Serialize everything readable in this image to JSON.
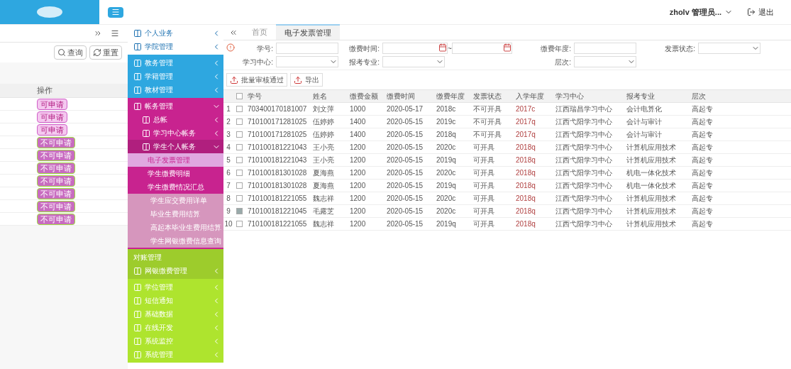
{
  "header": {
    "user": "zholv 管理员...",
    "logout": "退出"
  },
  "back_panel": {
    "buttons": [
      "查询",
      "重置"
    ],
    "column": "操作",
    "rows": [
      {
        "label": "可申请",
        "enabled": true
      },
      {
        "label": "可申请",
        "enabled": true
      },
      {
        "label": "可申请",
        "enabled": true
      },
      {
        "label": "不可申请",
        "enabled": false
      },
      {
        "label": "不可申请",
        "enabled": false
      },
      {
        "label": "不可申请",
        "enabled": false
      },
      {
        "label": "不可申请",
        "enabled": false
      },
      {
        "label": "不可申请",
        "enabled": false
      },
      {
        "label": "不可申请",
        "enabled": false
      },
      {
        "label": "不可申请",
        "enabled": false
      }
    ]
  },
  "sidebar": {
    "groups": [
      {
        "color": "#ffffff",
        "items": [
          {
            "label": "个人业务",
            "expanded": false,
            "selected": false
          },
          {
            "label": "学院管理",
            "expanded": false,
            "selected": false
          }
        ]
      },
      {
        "color": "#2ea7e0",
        "items": [
          {
            "label": "教务管理",
            "expanded": false,
            "selected": false
          },
          {
            "label": "学籍管理",
            "expanded": false,
            "selected": false
          },
          {
            "label": "教材管理",
            "expanded": false,
            "selected": false
          }
        ]
      },
      {
        "color": "#c8238f",
        "items": [
          {
            "label": "帐务管理",
            "expanded": true,
            "selected": false,
            "children": [
              {
                "label": "总帐",
                "expanded": false,
                "selected": false
              },
              {
                "label": "学习中心帐务",
                "expanded": false,
                "selected": false
              },
              {
                "label": "学生个人帐务",
                "expanded": true,
                "selected": false,
                "children": [
                  {
                    "label": "电子发票管理",
                    "selected": true
                  },
                  {
                    "label": "学生缴费明细",
                    "selected": false
                  },
                  {
                    "label": "学生缴费情况汇总",
                    "selected": false,
                    "children": [
                      {
                        "label": "学生应交费用详单",
                        "selected": false
                      },
                      {
                        "label": "毕业生费用结算",
                        "selected": false
                      },
                      {
                        "label": "高起本毕业生费用结算",
                        "selected": false
                      },
                      {
                        "label": "学生网银缴费信息查询",
                        "selected": false
                      }
                    ]
                  }
                ]
              }
            ]
          }
        ]
      },
      {
        "color": "#9dcc2c",
        "items": [
          {
            "label": "对账管理",
            "selected": false
          },
          {
            "label": "网银缴费管理",
            "expanded": false,
            "selected": false
          }
        ]
      },
      {
        "color": "#aee42e",
        "items": [
          {
            "label": "学位管理",
            "expanded": false,
            "selected": false
          },
          {
            "label": "短信通知",
            "expanded": false,
            "selected": false
          },
          {
            "label": "基础数据",
            "expanded": false,
            "selected": false
          },
          {
            "label": "在线开发",
            "expanded": false,
            "selected": false
          },
          {
            "label": "系统监控",
            "expanded": false,
            "selected": false
          },
          {
            "label": "系统管理",
            "expanded": false,
            "selected": false
          }
        ]
      }
    ]
  },
  "tabs": [
    {
      "label": "首页",
      "selected": false
    },
    {
      "label": "电子发票管理",
      "selected": true
    }
  ],
  "filters": [
    [
      {
        "label": "学号:",
        "kind": "text"
      },
      {
        "label": "缴费时间:",
        "kind": "daterange",
        "separator": "~"
      },
      {
        "label": "缴费年度:",
        "kind": "text"
      },
      {
        "label": "发票状态:",
        "kind": "select"
      }
    ],
    [
      {
        "label": "学习中心:",
        "kind": "select"
      },
      {
        "label": "报考专业:",
        "kind": "select"
      },
      {
        "label": "层次:",
        "kind": "select"
      }
    ]
  ],
  "actions": [
    "批量审核通过",
    "导出"
  ],
  "table": {
    "all_checked": false,
    "columns": [
      "学号",
      "姓名",
      "缴费金额",
      "缴费时间",
      "缴费年度",
      "发票状态",
      "入学年度",
      "学习中心",
      "报考专业",
      "层次"
    ],
    "rows": [
      {
        "index": "1",
        "checked": false,
        "cells": [
          "703400170181007",
          "刘文萍",
          "1000",
          "2020-05-17",
          "2018c",
          "不可开具",
          "2017c",
          "江西瑞昌学习中心",
          "会计电算化",
          "高起专"
        ]
      },
      {
        "index": "2",
        "checked": false,
        "cells": [
          "710100171281025",
          "伍婷婷",
          "1400",
          "2020-05-15",
          "2019c",
          "不可开具",
          "2017q",
          "江西弋阳学习中心",
          "会计与审计",
          "高起专"
        ]
      },
      {
        "index": "3",
        "checked": false,
        "cells": [
          "710100171281025",
          "伍婷婷",
          "1400",
          "2020-05-15",
          "2018q",
          "不可开具",
          "2017q",
          "江西弋阳学习中心",
          "会计与审计",
          "高起专"
        ]
      },
      {
        "index": "4",
        "checked": false,
        "cells": [
          "710100181221043",
          "王小亮",
          "1200",
          "2020-05-15",
          "2020c",
          "可开具",
          "2018q",
          "江西弋阳学习中心",
          "计算机应用技术",
          "高起专"
        ]
      },
      {
        "index": "5",
        "checked": false,
        "cells": [
          "710100181221043",
          "王小亮",
          "1200",
          "2020-05-15",
          "2019q",
          "可开具",
          "2018q",
          "江西弋阳学习中心",
          "计算机应用技术",
          "高起专"
        ]
      },
      {
        "index": "6",
        "checked": false,
        "cells": [
          "710100181301028",
          "夏海燕",
          "1200",
          "2020-05-15",
          "2020c",
          "可开具",
          "2018q",
          "江西弋阳学习中心",
          "机电一体化技术",
          "高起专"
        ]
      },
      {
        "index": "7",
        "checked": false,
        "cells": [
          "710100181301028",
          "夏海燕",
          "1200",
          "2020-05-15",
          "2019q",
          "可开具",
          "2018q",
          "江西弋阳学习中心",
          "机电一体化技术",
          "高起专"
        ]
      },
      {
        "index": "8",
        "checked": false,
        "cells": [
          "710100181221055",
          "魏志祥",
          "1200",
          "2020-05-15",
          "2020c",
          "可开具",
          "2018q",
          "江西弋阳学习中心",
          "计算机应用技术",
          "高起专"
        ]
      },
      {
        "index": "9",
        "checked": true,
        "cells": [
          "710100181221045",
          "毛露芝",
          "1200",
          "2020-05-15",
          "2020c",
          "可开具",
          "2018q",
          "江西弋阳学习中心",
          "计算机应用技术",
          "高起专"
        ]
      },
      {
        "index": "10",
        "checked": false,
        "cells": [
          "710100181221055",
          "魏志祥",
          "1200",
          "2020-05-15",
          "2019q",
          "可开具",
          "2018q",
          "江西弋阳学习中心",
          "计算机应用技术",
          "高起专"
        ]
      }
    ]
  }
}
